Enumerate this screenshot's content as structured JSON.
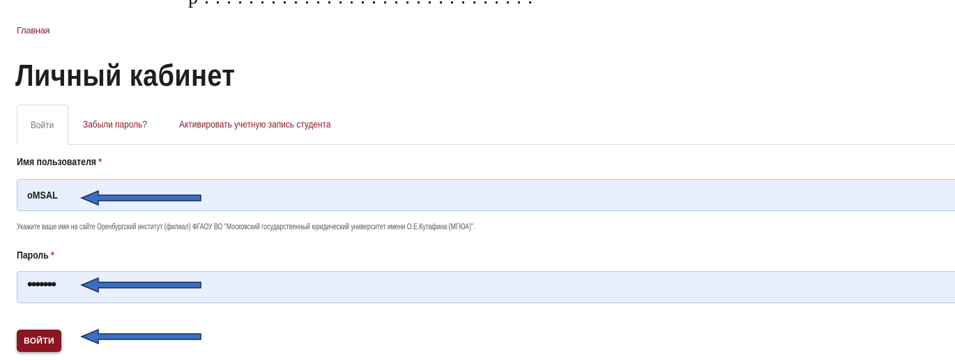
{
  "breadcrumb": {
    "home": "Главная"
  },
  "page": {
    "title": "Личный кабинет"
  },
  "tabs": [
    {
      "label": "Войти",
      "active": true
    },
    {
      "label": "Забыли пароль?",
      "active": false
    },
    {
      "label": "Активировать учетную запись студента",
      "active": false
    }
  ],
  "form": {
    "username": {
      "label": "Имя пользователя",
      "required_mark": "*",
      "value": "oMSAL",
      "hint": "Укажите ваше имя на сайте Оренбургский институт (филиал) ФГАОУ ВО \"Московский государственный юридический университет имени О.Е.Кутафина (МГЮА)\"."
    },
    "password": {
      "label": "Пароль",
      "required_mark": "*",
      "value": "•••••••"
    },
    "submit_label": "ВОЙТИ"
  },
  "annotations": {
    "arrow_color": "#3a6fc4",
    "arrow_outline": "#1a2c55"
  },
  "colors": {
    "accent": "#8b1520",
    "link": "#8b1a2b",
    "field_bg": "#e8f0fe"
  }
}
